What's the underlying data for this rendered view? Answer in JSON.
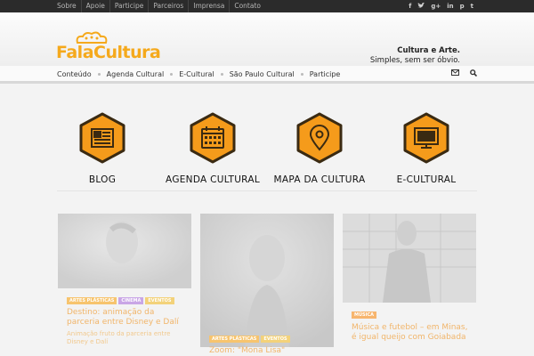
{
  "topbar": {
    "links": [
      "Sobre",
      "Apoie",
      "Participe",
      "Parceiros",
      "Imprensa",
      "Contato"
    ],
    "social": [
      "f",
      "t",
      "g+",
      "in",
      "p",
      "t"
    ]
  },
  "header": {
    "logo_text": "FalaCultura",
    "tagline_1": "Cultura e Arte.",
    "tagline_2": "Simples, sem ser óbvio."
  },
  "nav": {
    "items": [
      "Conteúdo",
      "Agenda Cultural",
      "E-Cultural",
      "São Paulo Cultural",
      "Participe"
    ],
    "icons": [
      "mail-icon",
      "search-icon"
    ]
  },
  "categories": [
    {
      "label": "BLOG",
      "icon": "newspaper-icon"
    },
    {
      "label": "AGENDA CULTURAL",
      "icon": "calendar-icon"
    },
    {
      "label": "MAPA DA CULTURA",
      "icon": "map-pin-icon"
    },
    {
      "label": "E-CULTURAL",
      "icon": "monitor-icon"
    }
  ],
  "colors": {
    "accent": "#f59b1b",
    "hex_border": "#3a2a12",
    "topbar": "#2b2b2b"
  },
  "cards": [
    {
      "tags": [
        "ARTES PLÁSTICAS",
        "CINEMA",
        "EVENTOS"
      ],
      "title": "Destino: animação da parceria entre Disney e Dalí",
      "excerpt": "Animação fruto da parceria entre Disney e Dalí"
    },
    {
      "tags": [
        "ARTES PLÁSTICAS",
        "EVENTOS"
      ],
      "title": "Zoom: \"Mona Lisa\"",
      "excerpt": ""
    },
    {
      "tags": [
        "MÚSICA"
      ],
      "title": "Música e futebol – em Minas, é igual queijo com Goiabada",
      "excerpt": ""
    }
  ]
}
